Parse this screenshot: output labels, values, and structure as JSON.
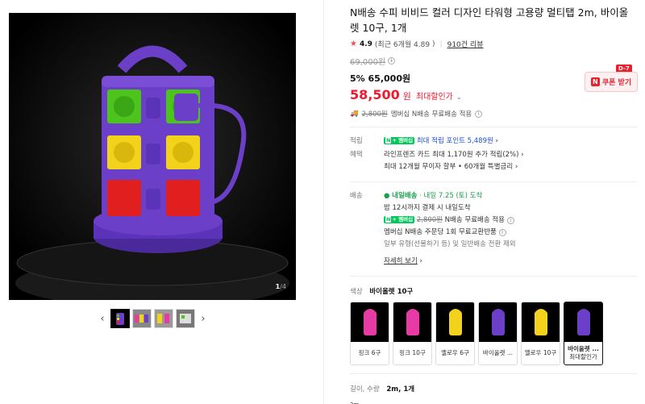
{
  "gallery": {
    "page_current": "1",
    "page_total": "/4",
    "prev_arrow": "‹",
    "next_arrow": "›"
  },
  "product": {
    "title": "N배송 수피 비비드 컬러 디자인 타워형 고용량 멀티탭 2m, 바이올렛 10구, 1개",
    "rating": "4.9",
    "rating_detail": "(최근 6개월 4.89",
    "review_count": "910건 리뷰",
    "original_price": "69,000원",
    "discount_pct": "5%",
    "discount_price": "65,000원",
    "final_price_num": "58,500",
    "final_price_unit": "원",
    "final_price_label": "최대할인가",
    "coupon_label": "쿠폰 받기",
    "coupon_badge": "D-7",
    "ship_price_struck": "2,800원",
    "ship_text": "멤버십 N배송 무료배송 적용"
  },
  "points": {
    "label": "적립",
    "text": "최대 적립 포인트 5,489원"
  },
  "benefit": {
    "label": "혜택",
    "line1": "라인프렌즈 카드 최대 1,170원 추가 적립(2%)",
    "line2": "최대 12개월 무이자 할부 • 60개월 특별금리"
  },
  "delivery": {
    "label": "배송",
    "badge": "내일배송",
    "arrival": "내일 7.25 (토) 도착",
    "cutoff": "밤 12시까지 결제 시 내일도착",
    "ship_struck": "2,800원",
    "ship_free": "N배송 무료배송 적용",
    "exchange": "멤버십 N배송 주문당 1회 무료교환반품",
    "note": "일부 유형(선물하기 등) 및 일반배송 전환 제외",
    "more": "자세히 보기"
  },
  "options": {
    "color_label": "색상",
    "color_selected": "바이올렛 10구",
    "items": [
      {
        "label": "핑크 6구",
        "color": "#e83aa4"
      },
      {
        "label": "핑크 10구",
        "color": "#e83aa4"
      },
      {
        "label": "옐로우 6구",
        "color": "#f2d21a"
      },
      {
        "label": "바이올렛 ...",
        "color": "#6b3fc7"
      },
      {
        "label": "옐로우 10구",
        "color": "#f2d21a"
      },
      {
        "label": "바이올렛 ...",
        "sub": "최대할인가",
        "color": "#6b3fc7"
      }
    ],
    "length_label": "길이, 수량",
    "length_selected": "2m, 1개",
    "more_label": "2m"
  },
  "colors": {
    "accent_red": "#f0192e",
    "naver_green": "#03c75a",
    "violet": "#6b3fc7"
  }
}
